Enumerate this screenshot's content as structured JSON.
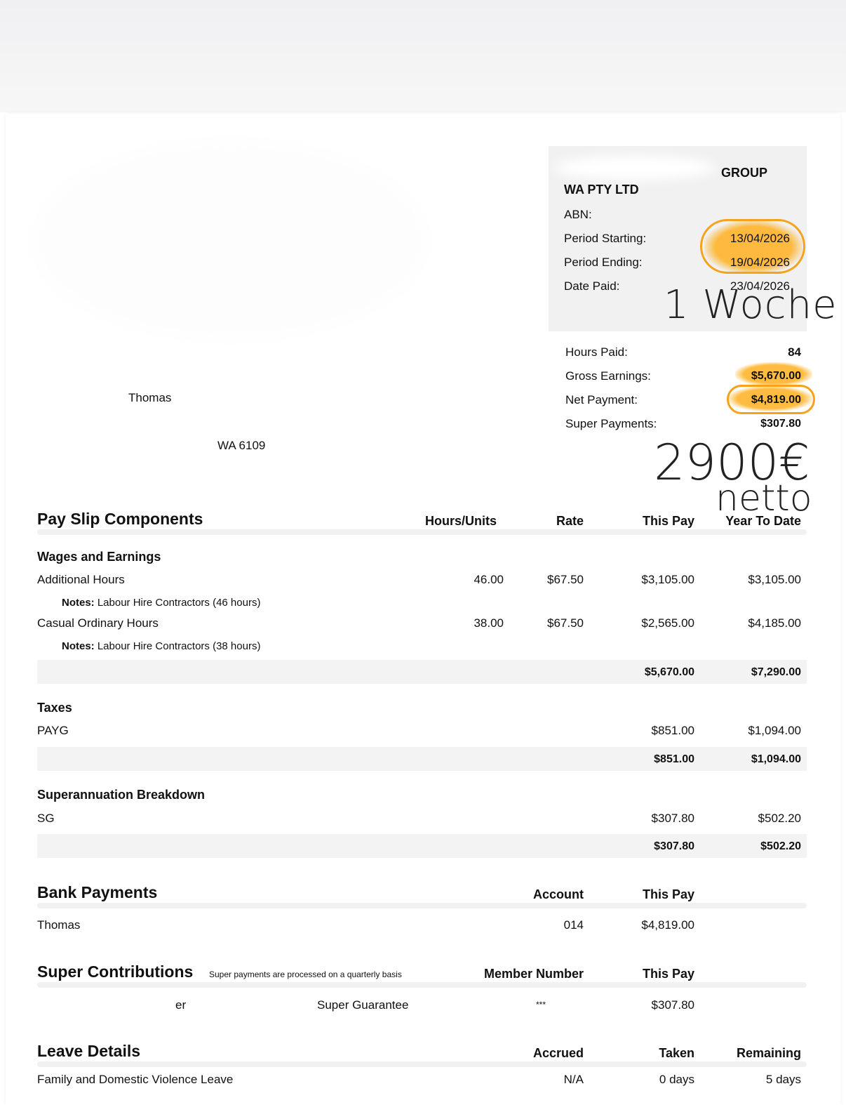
{
  "company": {
    "name_line1": "GROUP",
    "name_line2": "WA PTY LTD",
    "abn_label": "ABN:",
    "period_start_label": "Period Starting:",
    "period_start": "13/04/2026",
    "period_end_label": "Period Ending:",
    "period_end": "19/04/2026",
    "date_paid_label": "Date Paid:",
    "date_paid": "23/04/2026"
  },
  "summary": {
    "hours_label": "Hours Paid:",
    "hours": "84",
    "gross_label": "Gross Earnings:",
    "gross": "$5,670.00",
    "net_label": "Net Payment:",
    "net": "$4,819.00",
    "super_label": "Super Payments:",
    "super": "$307.80"
  },
  "employee": {
    "name": "Thomas",
    "postcode": "WA 6109"
  },
  "annotations": {
    "week": "1 Woche",
    "net_eur": "2900€",
    "net_word": "netto",
    "highlight_color": "#f7a21b"
  },
  "components": {
    "title": "Pay Slip Components",
    "col_hours": "Hours/Units",
    "col_rate": "Rate",
    "col_this": "This Pay",
    "col_ytd": "Year To Date",
    "wages_title": "Wages and Earnings",
    "rows": [
      {
        "label": "Additional Hours",
        "hours": "46.00",
        "rate": "$67.50",
        "this": "$3,105.00",
        "ytd": "$3,105.00",
        "notes_label": "Notes:",
        "notes": "Labour Hire Contractors (46 hours)"
      },
      {
        "label": "Casual Ordinary Hours",
        "hours": "38.00",
        "rate": "$67.50",
        "this": "$2,565.00",
        "ytd": "$4,185.00",
        "notes_label": "Notes:",
        "notes": "Labour Hire Contractors (38 hours)"
      }
    ],
    "wages_total_this": "$5,670.00",
    "wages_total_ytd": "$7,290.00",
    "taxes_title": "Taxes",
    "tax_label": "PAYG",
    "tax_this": "$851.00",
    "tax_ytd": "$1,094.00",
    "tax_total_this": "$851.00",
    "tax_total_ytd": "$1,094.00",
    "super_title": "Superannuation Breakdown",
    "sg_label": "SG",
    "sg_this": "$307.80",
    "sg_ytd": "$502.20",
    "sg_total_this": "$307.80",
    "sg_total_ytd": "$502.20"
  },
  "bank": {
    "title": "Bank Payments",
    "col_account": "Account",
    "col_this": "This Pay",
    "name": "Thomas",
    "account": "014",
    "amount": "$4,819.00"
  },
  "super_contrib": {
    "title": "Super Contributions",
    "note": "Super payments are processed on a quarterly basis",
    "col_member": "Member Number",
    "col_this": "This Pay",
    "fund": "er",
    "type": "Super Guarantee",
    "member": "***",
    "amount": "$307.80"
  },
  "leave": {
    "title": "Leave Details",
    "col_accrued": "Accrued",
    "col_taken": "Taken",
    "col_remaining": "Remaining",
    "type": "Family and Domestic Violence Leave",
    "accrued": "N/A",
    "taken": "0 days",
    "remaining": "5 days"
  }
}
